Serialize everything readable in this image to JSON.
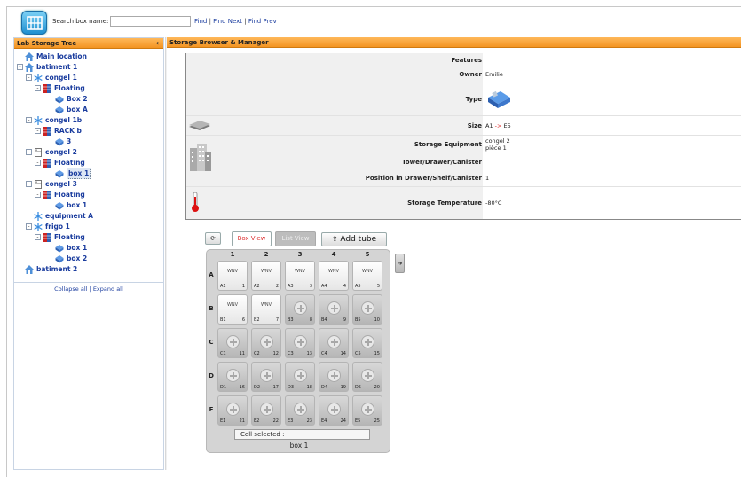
{
  "search": {
    "label": "Search box name:",
    "value": "",
    "placeholder": ""
  },
  "find_links": {
    "find": "Find",
    "find_next": "Find Next",
    "find_prev": "Find Prev",
    "sep": "|"
  },
  "left_panel": {
    "title": "Lab Storage Tree",
    "collapse_icon": "chevron-left-icon",
    "tree": [
      {
        "label": "Main location",
        "icon": "house-icon",
        "level": 0,
        "toggle": ""
      },
      {
        "label": "batiment 1",
        "icon": "house-icon",
        "level": 0,
        "toggle": "-"
      },
      {
        "label": "congel 1",
        "icon": "snowflake-icon",
        "level": 1,
        "toggle": "-"
      },
      {
        "label": "Floating",
        "icon": "rack-icon",
        "level": 2,
        "toggle": "-"
      },
      {
        "label": "Box 2",
        "icon": "box-icon",
        "level": 3,
        "toggle": ""
      },
      {
        "label": "box A",
        "icon": "box-icon",
        "level": 3,
        "toggle": ""
      },
      {
        "label": "congel 1b",
        "icon": "snowflake-icon",
        "level": 1,
        "toggle": "-"
      },
      {
        "label": "RACK b",
        "icon": "rack-icon",
        "level": 2,
        "toggle": "-"
      },
      {
        "label": "3",
        "icon": "box-icon",
        "level": 3,
        "toggle": ""
      },
      {
        "label": "congel 2",
        "icon": "fridge-icon",
        "level": 1,
        "toggle": "-"
      },
      {
        "label": "Floating",
        "icon": "rack-icon",
        "level": 2,
        "toggle": "-"
      },
      {
        "label": "box 1",
        "icon": "box-icon",
        "level": 3,
        "toggle": "",
        "selected": true
      },
      {
        "label": "congel 3",
        "icon": "fridge-icon",
        "level": 1,
        "toggle": "-"
      },
      {
        "label": "Floating",
        "icon": "rack-icon",
        "level": 2,
        "toggle": "-"
      },
      {
        "label": "box 1",
        "icon": "box-icon",
        "level": 3,
        "toggle": ""
      },
      {
        "label": "equipment A",
        "icon": "snowflake-icon",
        "level": 1,
        "toggle": ""
      },
      {
        "label": "frigo 1",
        "icon": "snowflake-icon",
        "level": 1,
        "toggle": "-"
      },
      {
        "label": "Floating",
        "icon": "rack-icon",
        "level": 2,
        "toggle": "-"
      },
      {
        "label": "box 1",
        "icon": "box-icon",
        "level": 3,
        "toggle": ""
      },
      {
        "label": "box 2",
        "icon": "box-icon",
        "level": 3,
        "toggle": ""
      },
      {
        "label": "batiment 2",
        "icon": "house-icon",
        "level": 0,
        "toggle": ""
      }
    ],
    "collapse_all": "Collapse all",
    "expand_all": "Expand all",
    "links_sep": "|"
  },
  "right_panel": {
    "title": "Storage Browser & Manager",
    "info": {
      "features_label": "Features",
      "owner_label": "Owner",
      "owner_value": "Emilie",
      "type_label": "Type",
      "size_label": "Size",
      "size_from": "A1",
      "size_arrow": "->",
      "size_to": "E5",
      "equipment_label": "Storage Equipment",
      "equipment_value_1": "congel 2",
      "equipment_value_2": "pièce 1",
      "tower_label": "Tower/Drawer/Canister",
      "position_label": "Position in Drawer/Shelf/Canister",
      "position_value": "1",
      "temp_label": "Storage Temperature",
      "temp_value": "-80°C"
    },
    "toolbar": {
      "refresh_icon": "refresh-icon",
      "box_view": "Box View",
      "list_view": "List View",
      "add_tube": "Add tube"
    },
    "grid": {
      "columns": [
        "1",
        "2",
        "3",
        "4",
        "5"
      ],
      "rows": [
        "A",
        "B",
        "C",
        "D",
        "E"
      ],
      "filled_label": "WNV",
      "cells": [
        {
          "id": "A1",
          "n": "1",
          "filled": true
        },
        {
          "id": "A2",
          "n": "2",
          "filled": true
        },
        {
          "id": "A3",
          "n": "3",
          "filled": true
        },
        {
          "id": "A4",
          "n": "4",
          "filled": true
        },
        {
          "id": "A5",
          "n": "5",
          "filled": true
        },
        {
          "id": "B1",
          "n": "6",
          "filled": true
        },
        {
          "id": "B2",
          "n": "7",
          "filled": true
        },
        {
          "id": "B3",
          "n": "8",
          "filled": false
        },
        {
          "id": "B4",
          "n": "9",
          "filled": false
        },
        {
          "id": "B5",
          "n": "10",
          "filled": false
        },
        {
          "id": "C1",
          "n": "11",
          "filled": false
        },
        {
          "id": "C2",
          "n": "12",
          "filled": false
        },
        {
          "id": "C3",
          "n": "13",
          "filled": false
        },
        {
          "id": "C4",
          "n": "14",
          "filled": false
        },
        {
          "id": "C5",
          "n": "15",
          "filled": false
        },
        {
          "id": "D1",
          "n": "16",
          "filled": false
        },
        {
          "id": "D2",
          "n": "17",
          "filled": false
        },
        {
          "id": "D3",
          "n": "18",
          "filled": false
        },
        {
          "id": "D4",
          "n": "19",
          "filled": false
        },
        {
          "id": "D5",
          "n": "20",
          "filled": false
        },
        {
          "id": "E1",
          "n": "21",
          "filled": false
        },
        {
          "id": "E2",
          "n": "22",
          "filled": false
        },
        {
          "id": "E3",
          "n": "23",
          "filled": false
        },
        {
          "id": "E4",
          "n": "24",
          "filled": false
        },
        {
          "id": "E5",
          "n": "25",
          "filled": false
        }
      ],
      "cell_selected_label": "Cell selected :",
      "box_name": "box 1"
    },
    "colors": {
      "accent_orange": "#f39422",
      "link_blue": "#1a3c9e",
      "size_arrow_red": "#d22222"
    }
  }
}
